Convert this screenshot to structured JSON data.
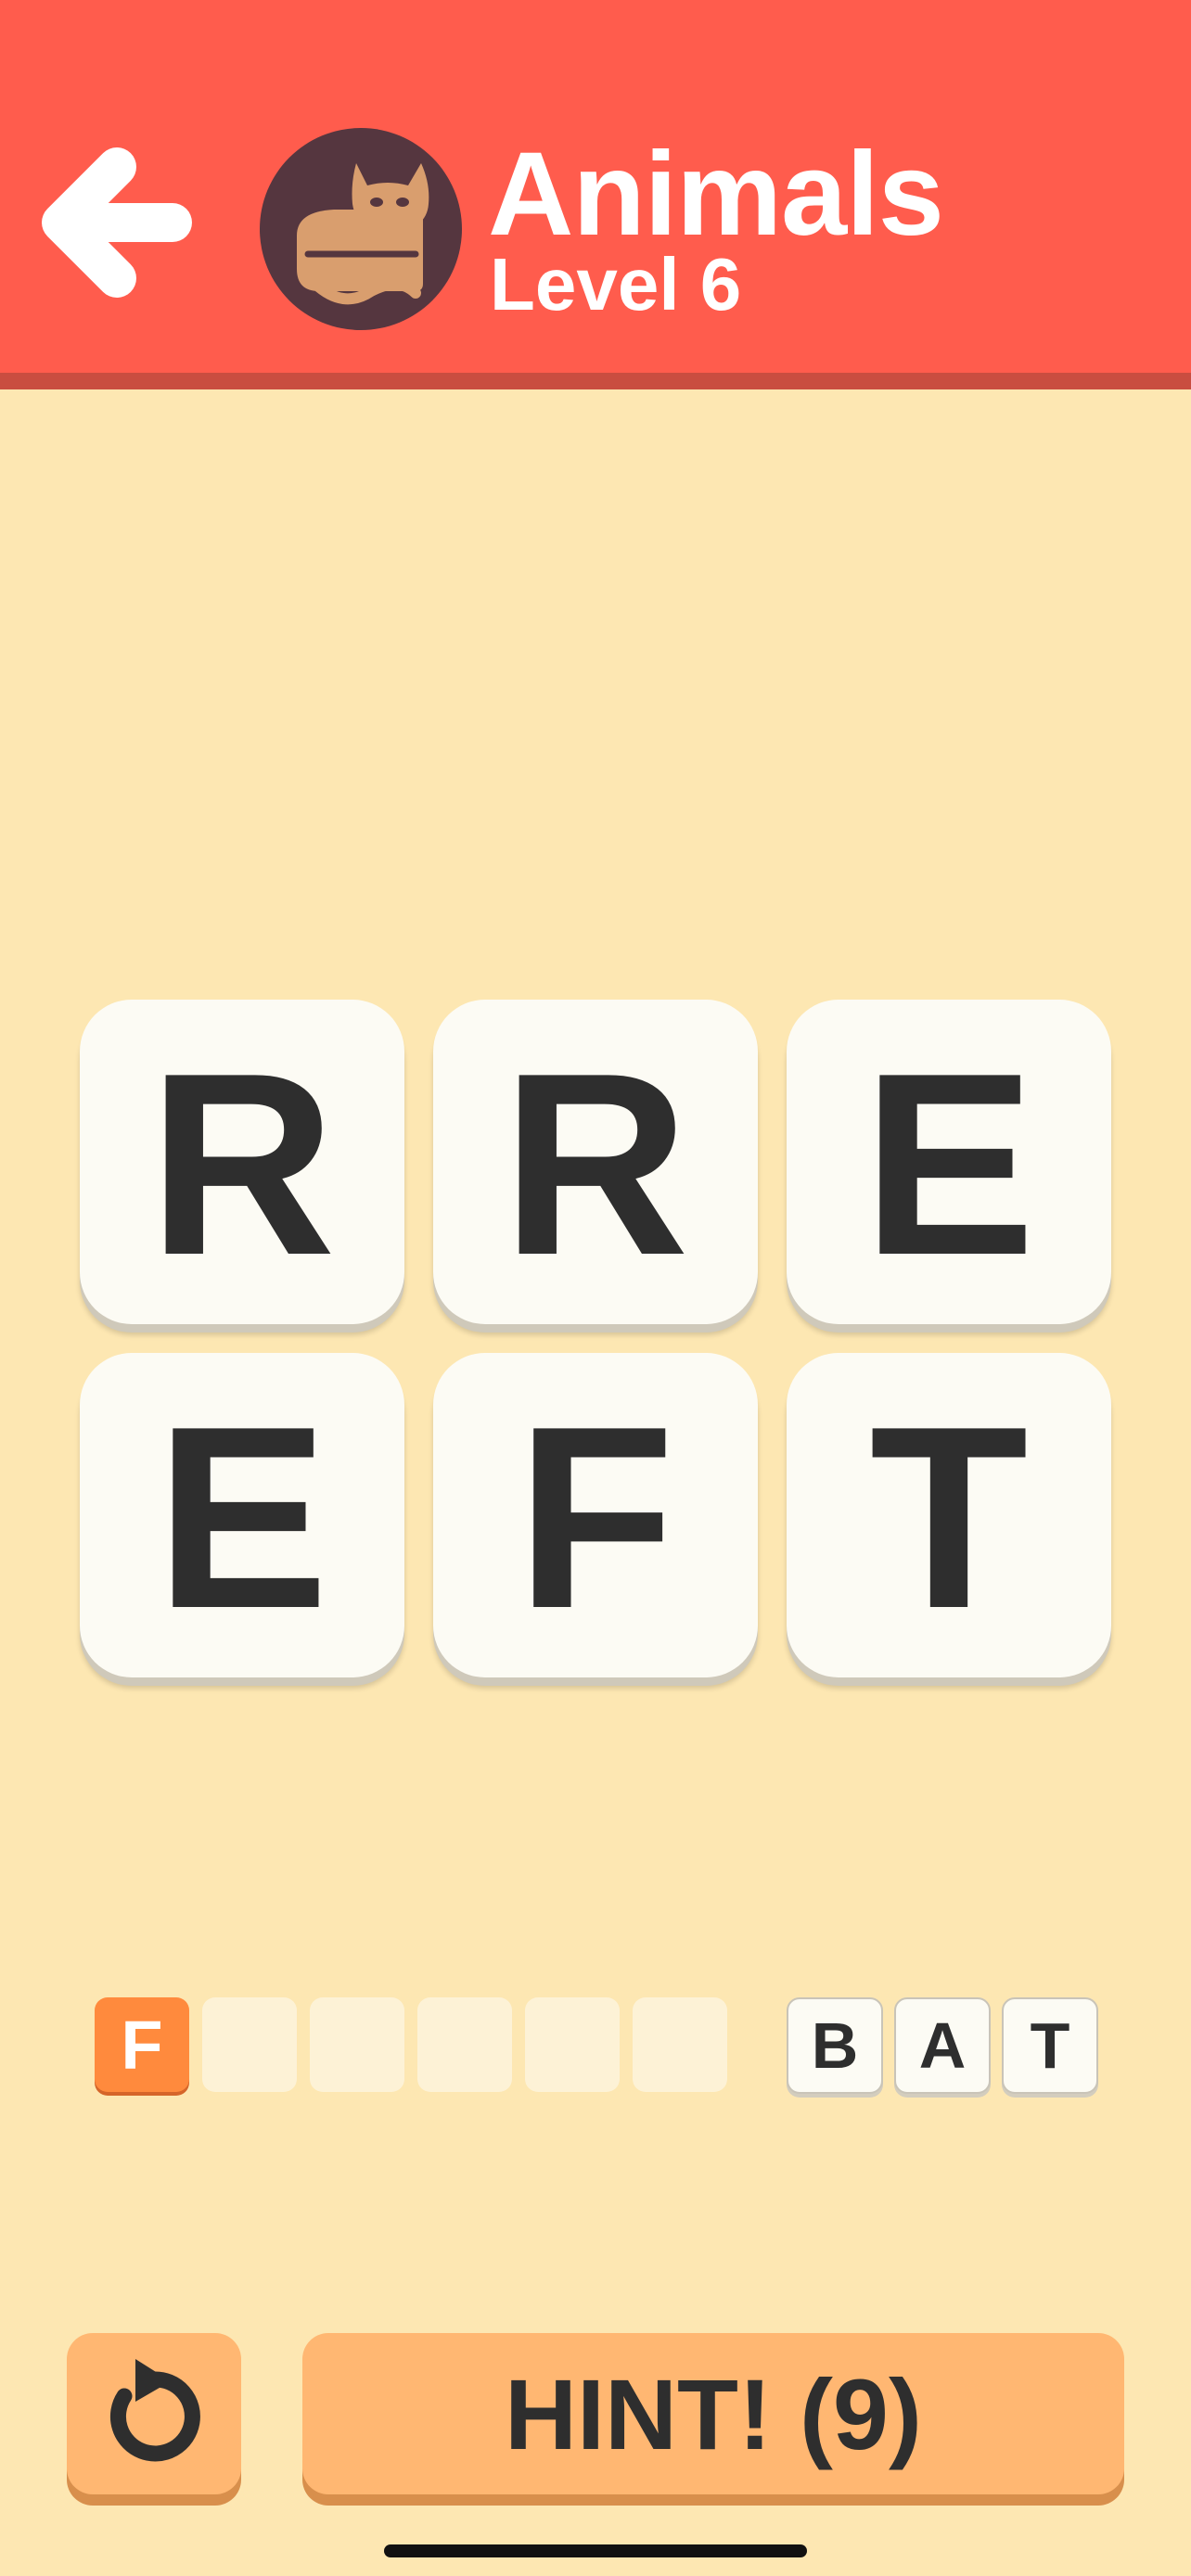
{
  "header": {
    "category": "Animals",
    "level": "Level 6",
    "colors": {
      "background": "#FF5C4D",
      "shadow": "#C94D40",
      "text": "#FFFFFF"
    },
    "back_icon": "arrow-left-icon",
    "avatar_icon": "cat-icon"
  },
  "board": {
    "tiles": [
      "R",
      "R",
      "E",
      "E",
      "F",
      "T"
    ]
  },
  "answer": {
    "length": 6,
    "filled": [
      "F",
      "",
      "",
      "",
      "",
      ""
    ]
  },
  "found_word": [
    "B",
    "A",
    "T"
  ],
  "controls": {
    "restart_icon": "restart-icon",
    "hint_label": "HINT! (9)"
  },
  "colors": {
    "page_background": "#FDE7B2",
    "tile": "#FCFBF4",
    "button": "#FFB772",
    "filled_slot": "#FF8A3D"
  }
}
